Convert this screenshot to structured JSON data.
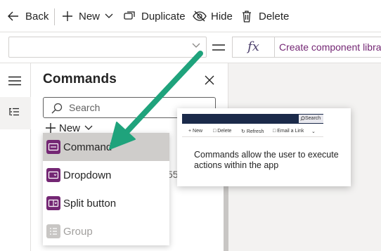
{
  "toolbar": {
    "back_label": "Back",
    "new_label": "New",
    "duplicate_label": "Duplicate",
    "hide_label": "Hide",
    "delete_label": "Delete"
  },
  "formula_bar": {
    "property_value": "",
    "fx_label": "fx",
    "formula_text": "Create component library"
  },
  "panel": {
    "title": "Commands",
    "search_placeholder": "Search",
    "new_label": "New",
    "partial_text": "55"
  },
  "menu": {
    "items": [
      {
        "label": "Command",
        "icon": "command-icon",
        "highlighted": true,
        "disabled": false
      },
      {
        "label": "Dropdown",
        "icon": "dropdown-icon",
        "highlighted": false,
        "disabled": false
      },
      {
        "label": "Split button",
        "icon": "split-button-icon",
        "highlighted": false,
        "disabled": false
      },
      {
        "label": "Group",
        "icon": "group-icon",
        "highlighted": false,
        "disabled": true
      }
    ]
  },
  "tooltip": {
    "preview_search": "Search",
    "preview_commands": [
      "New",
      "Delete",
      "Refresh",
      "Email a Link"
    ],
    "description": "Commands allow the user to execute actions within the app"
  },
  "colors": {
    "accent": "#742774",
    "arrow": "#1fa37c",
    "preview_bar": "#1b2a4a"
  }
}
